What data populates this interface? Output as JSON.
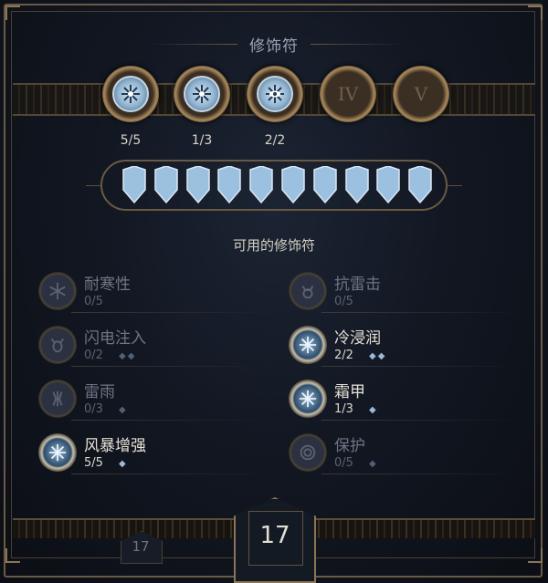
{
  "title": "修饰符",
  "slots": [
    {
      "kind": "gem",
      "icon": "frost-sigil-icon",
      "count": "5/5"
    },
    {
      "kind": "gem",
      "icon": "frost-sigil-icon",
      "count": "1/3"
    },
    {
      "kind": "gem",
      "icon": "frost-eye-icon",
      "count": "2/2"
    },
    {
      "kind": "locked",
      "numeral": "IV"
    },
    {
      "kind": "locked",
      "numeral": "V"
    }
  ],
  "points": {
    "total": 10,
    "filled": 10,
    "color": "#9cc0e0"
  },
  "available_title": "可用的修饰符",
  "modifiers": [
    {
      "name": "耐寒性",
      "count": "0/5",
      "pips": "",
      "active": false,
      "icon": "snowflake-rune-icon"
    },
    {
      "name": "抗雷击",
      "count": "0/5",
      "pips": "",
      "active": false,
      "icon": "horned-mask-icon"
    },
    {
      "name": "闪电注入",
      "count": "0/2",
      "pips": "◆◆",
      "active": false,
      "icon": "storm-mask-icon"
    },
    {
      "name": "冷浸润",
      "count": "2/2",
      "pips": "◆◆",
      "active": true,
      "icon": "frost-eye-icon"
    },
    {
      "name": "雷雨",
      "count": "0/3",
      "pips": "◆",
      "active": false,
      "icon": "lightning-claw-icon"
    },
    {
      "name": "霜甲",
      "count": "1/3",
      "pips": "◆",
      "active": true,
      "icon": "frost-sigil-icon"
    },
    {
      "name": "风暴增强",
      "count": "5/5",
      "pips": "◆",
      "active": true,
      "icon": "frost-sigil-icon"
    },
    {
      "name": "保护",
      "count": "0/5",
      "pips": "◆",
      "active": false,
      "icon": "spiral-ward-icon"
    }
  ],
  "level": {
    "current": "17",
    "previous": "17"
  }
}
